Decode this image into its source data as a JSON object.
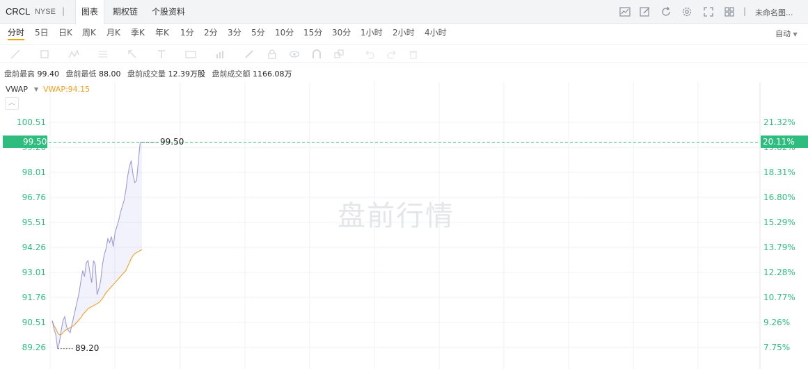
{
  "header": {
    "ticker": "CRCL",
    "exchange": "NYSE",
    "separator": "|",
    "tabs": [
      {
        "label": "图表",
        "active": true
      },
      {
        "label": "期权链",
        "active": false
      },
      {
        "label": "个股资料",
        "active": false
      }
    ],
    "icons": [
      "chart-icon",
      "edit-icon",
      "refresh-icon",
      "gear-icon",
      "fullscreen-icon",
      "grid-layout-icon"
    ],
    "separator2": "|",
    "layout_name": "未命名图..."
  },
  "periods": [
    {
      "label": "分时",
      "active": true
    },
    {
      "label": "5日"
    },
    {
      "label": "日K"
    },
    {
      "label": "周K"
    },
    {
      "label": "月K"
    },
    {
      "label": "季K"
    },
    {
      "label": "年K"
    },
    {
      "label": "1分"
    },
    {
      "label": "2分"
    },
    {
      "label": "3分"
    },
    {
      "label": "5分"
    },
    {
      "label": "10分"
    },
    {
      "label": "15分"
    },
    {
      "label": "30分"
    },
    {
      "label": "1小时"
    },
    {
      "label": "2小时"
    },
    {
      "label": "4小时"
    }
  ],
  "scale_mode": "自动",
  "drawing_tools": [
    "line-tool-icon",
    "rectangle-tool-icon",
    "pattern-tool-icon",
    "fibonacci-tool-icon",
    "arrow-tool-icon",
    "text-tool-icon",
    "label-tool-icon",
    "measure-tool-icon",
    "brush-tool-icon",
    "lock-icon",
    "eye-icon",
    "magnet-icon",
    "layers-icon",
    "undo-icon",
    "redo-icon",
    "trash-icon"
  ],
  "stats": {
    "high_label": "盘前最高",
    "high": "99.40",
    "low_label": "盘前最低",
    "low": "88.00",
    "volume_label": "盘前成交量",
    "volume": "12.39万股",
    "amount_label": "盘前成交额",
    "amount": "1166.08万"
  },
  "indicator": {
    "name": "VWAP",
    "value_text": "VWAP:94.15"
  },
  "watermark": "盘前行情",
  "current": {
    "price_tag": "99.50",
    "pct_tag": "20.11%",
    "annotation": "99.50"
  },
  "low_annotation": "89.20",
  "colors": {
    "up": "#2ebd7e",
    "price_line": "#9b9bd8",
    "vwap_line": "#f0a020",
    "grid": "#eef0f3"
  },
  "chart_data": {
    "type": "line",
    "title": "",
    "ylim": [
      88.7,
      101.2
    ],
    "left_ticks": [
      "100.51",
      "99.26",
      "98.01",
      "96.76",
      "95.51",
      "94.26",
      "93.01",
      "91.76",
      "90.51",
      "89.26"
    ],
    "left_tick_values": [
      100.51,
      99.26,
      98.01,
      96.76,
      95.51,
      94.26,
      93.01,
      91.76,
      90.51,
      89.26
    ],
    "right_ticks": [
      "21.32%",
      "19.82%",
      "18.31%",
      "16.80%",
      "15.29%",
      "13.79%",
      "12.28%",
      "10.77%",
      "9.26%",
      "7.75%"
    ],
    "reference_price": 99.5,
    "series": [
      {
        "values": [
          90.6,
          90.2,
          89.9,
          89.2,
          89.5,
          90.1,
          90.6,
          90.8,
          90.3,
          90.1,
          90.0,
          90.4,
          90.8,
          91.2,
          91.6,
          92.0,
          92.6,
          93.1,
          92.8,
          93.5,
          93.6,
          93.0,
          92.5,
          93.6,
          93.4,
          91.9,
          92.2,
          92.6,
          93.4,
          93.9,
          94.2,
          94.7,
          94.5,
          94.8,
          94.3,
          95.0,
          95.3,
          95.6,
          96.0,
          96.3,
          96.6,
          97.1,
          97.8,
          98.3,
          98.6,
          97.9,
          97.5,
          97.6,
          98.6,
          99.5,
          99.5
        ]
      },
      {
        "values": [
          90.6,
          90.35,
          90.2,
          90.0,
          89.9,
          89.9,
          90.0,
          90.1,
          90.15,
          90.2,
          90.25,
          90.3,
          90.35,
          90.45,
          90.55,
          90.65,
          90.75,
          90.9,
          91.0,
          91.1,
          91.2,
          91.25,
          91.3,
          91.35,
          91.4,
          91.45,
          91.5,
          91.6,
          91.7,
          91.85,
          92.0,
          92.1,
          92.2,
          92.3,
          92.4,
          92.5,
          92.6,
          92.7,
          92.8,
          92.9,
          93.0,
          93.1,
          93.3,
          93.5,
          93.7,
          93.85,
          93.95,
          94.0,
          94.05,
          94.1,
          94.15
        ]
      }
    ]
  }
}
